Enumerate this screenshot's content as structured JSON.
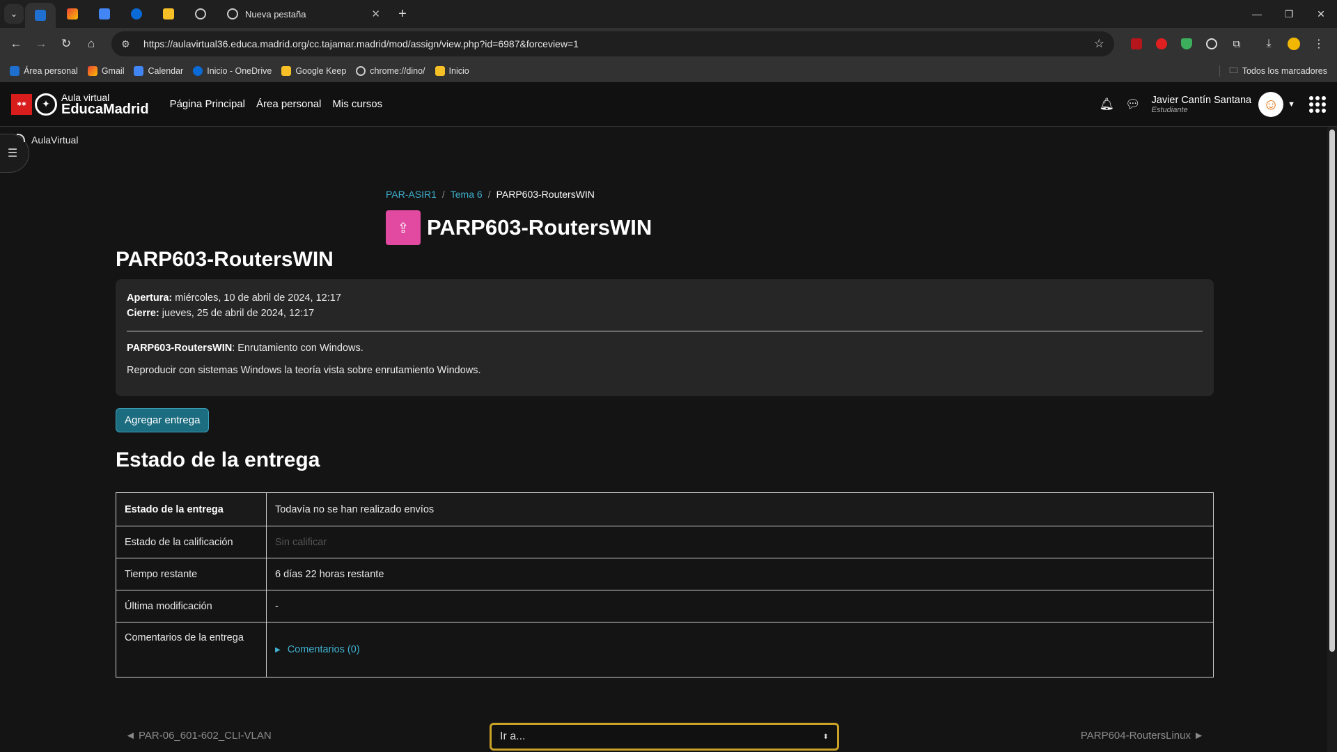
{
  "browser": {
    "tab_title": "Nueva pestaña",
    "url": "https://aulavirtual36.educa.madrid.org/cc.tajamar.madrid/mod/assign/view.php?id=6987&forceview=1",
    "bookmarks": [
      "Área personal",
      "Gmail",
      "Calendar",
      "Inicio - OneDrive",
      "Google Keep",
      "chrome://dino/",
      "Inicio"
    ],
    "all_bookmarks": "Todos los marcadores"
  },
  "header": {
    "logo_small": "Aula virtual",
    "logo_big": "EducaMadrid",
    "nav": [
      "Página Principal",
      "Área personal",
      "Mis cursos"
    ],
    "user_name": "Javier Cantín Santana",
    "user_role": "Estudiante"
  },
  "drawer_label": "AulaVirtual",
  "breadcrumb": [
    "PAR-ASIR1",
    "Tema 6",
    "PARP603-RoutersWIN"
  ],
  "page_title": "PARP603-RoutersWIN",
  "assignment": {
    "heading": "PARP603-RoutersWIN",
    "opening_label": "Apertura:",
    "opening_value": "miércoles, 10 de abril de 2024, 12:17",
    "closing_label": "Cierre:",
    "closing_value": "jueves, 25 de abril de 2024, 12:17",
    "desc_bold": "PARP603-RoutersWIN",
    "desc_rest": ": Enrutamiento con Windows.",
    "desc_2": "Reproducir con sistemas Windows la teoría vista sobre enrutamiento Windows."
  },
  "add_submission": "Agregar entrega",
  "status_heading": "Estado de la entrega",
  "status_table": [
    {
      "label": "Estado de la entrega",
      "value": "Todavía no se han realizado envíos"
    },
    {
      "label": "Estado de la calificación",
      "value": "Sin calificar"
    },
    {
      "label": "Tiempo restante",
      "value": "6 días 22 horas restante"
    },
    {
      "label": "Última modificación",
      "value": "-"
    },
    {
      "label": "Comentarios de la entrega",
      "value": "Comentarios (0)"
    }
  ],
  "footer": {
    "prev": "◄ PAR-06_601-602_CLI-VLAN",
    "jump": "Ir a...",
    "next": "PARP604-RoutersLinux ►"
  },
  "colors": {
    "link": "#3fb0cf",
    "primary_button": "#1c6d80",
    "activity_icon": "#e14aa0",
    "jump_border": "#c9a227"
  }
}
